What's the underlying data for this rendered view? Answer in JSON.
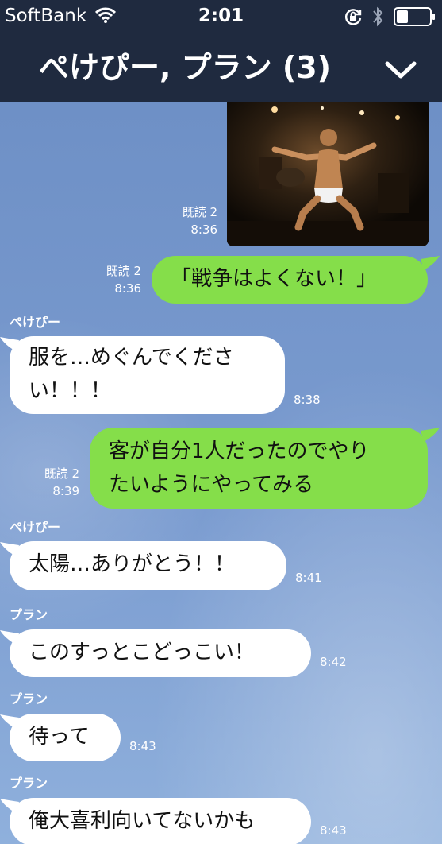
{
  "status_bar": {
    "carrier": "SoftBank",
    "time": "2:01",
    "icons": [
      "wifi-icon",
      "rotation-lock-icon",
      "bluetooth-icon",
      "battery-icon"
    ]
  },
  "header": {
    "title": "ぺけぴー, プラン (3)",
    "collapse_icon": "chevron-down-icon"
  },
  "colors": {
    "header": "#1f2a3f",
    "outgoing_bubble": "#85de4a",
    "incoming_bubble": "#ffffff",
    "background": "#7b9cd0"
  },
  "messages": [
    {
      "type": "image",
      "direction": "out",
      "read": "既読 2",
      "time": "8:36"
    },
    {
      "type": "text",
      "direction": "out",
      "lines": [
        "「戦争はよくない！」"
      ],
      "read": "既読 2",
      "time": "8:36"
    },
    {
      "type": "text",
      "direction": "in",
      "sender": "ぺけぴー",
      "lines": [
        "服を…めぐんでくださ",
        "い！！！"
      ],
      "time": "8:38"
    },
    {
      "type": "text",
      "direction": "out",
      "lines": [
        "客が自分1人だったのでやり",
        "たいようにやってみる"
      ],
      "read": "既読 2",
      "time": "8:39"
    },
    {
      "type": "text",
      "direction": "in",
      "sender": "ぺけぴー",
      "lines": [
        "太陽…ありがとう！！"
      ],
      "time": "8:41"
    },
    {
      "type": "text",
      "direction": "in",
      "sender": "プラン",
      "lines": [
        "このすっとこどっこい！"
      ],
      "time": "8:42"
    },
    {
      "type": "text",
      "direction": "in",
      "sender": "プラン",
      "lines": [
        "待って"
      ],
      "time": "8:43"
    },
    {
      "type": "text",
      "direction": "in",
      "sender": "プラン",
      "lines": [
        "俺大喜利向いてないかも"
      ],
      "time": "8:43"
    }
  ]
}
